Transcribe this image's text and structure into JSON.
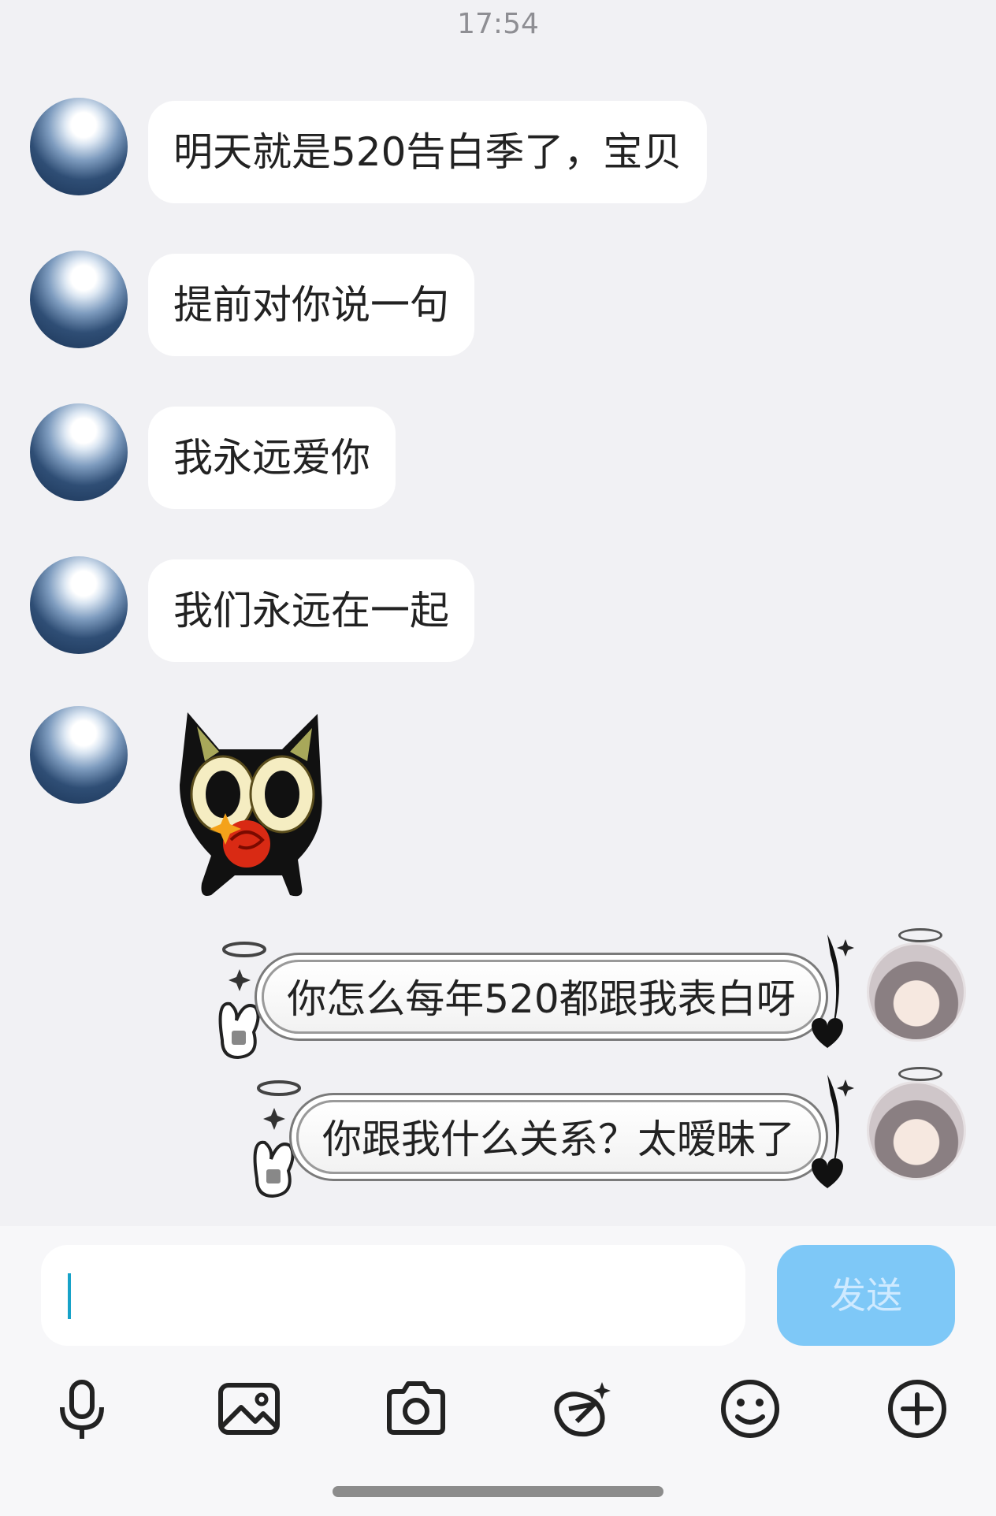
{
  "status": {
    "time": "17:54"
  },
  "messages_left": [
    {
      "text": "明天就是520告白季了，宝贝"
    },
    {
      "text": "提前对你说一句"
    },
    {
      "text": "我永远爱你"
    },
    {
      "text": "我们永远在一起"
    }
  ],
  "sticker": {
    "icon": "black-cat-with-rose-sticker"
  },
  "messages_right": [
    {
      "text": "你怎么每年520都跟我表白呀"
    },
    {
      "text": "你跟我什么关系？太暧昧了"
    }
  ],
  "composer": {
    "input_value": "",
    "send_label": "发送"
  },
  "toolbar": {
    "icons": [
      "microphone-icon",
      "image-icon",
      "camera-icon",
      "sticker-pen-icon",
      "emoji-icon",
      "plus-icon"
    ]
  }
}
